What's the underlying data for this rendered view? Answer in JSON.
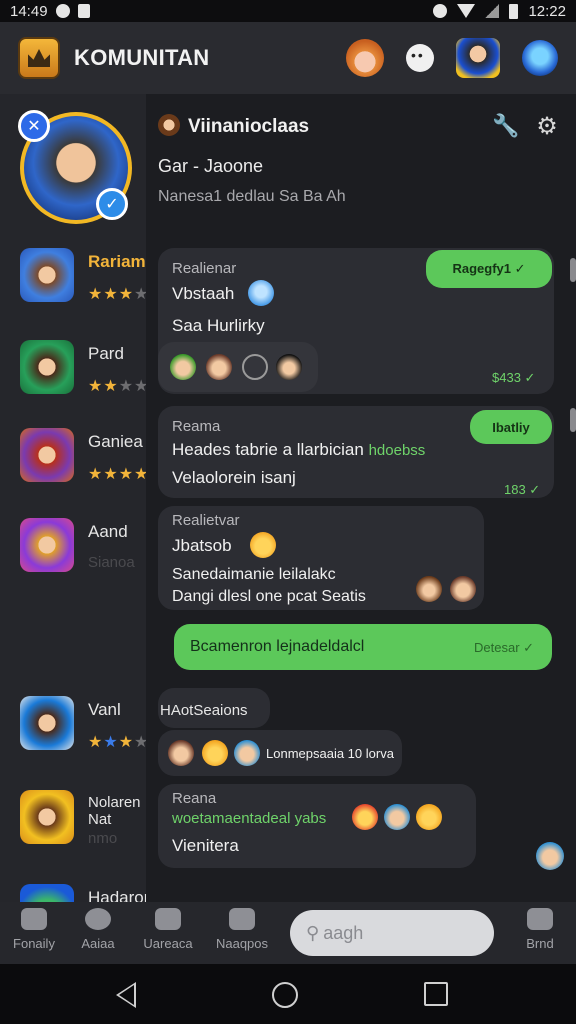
{
  "status_bar": {
    "time": "14:49",
    "clock_right": "12:22"
  },
  "app_bar": {
    "title": "KOMUNITAN"
  },
  "sidebar": {
    "games": [
      {
        "name": "Rariama",
        "rating": 3,
        "style": "gold"
      },
      {
        "name": "Pard",
        "rating": 2,
        "style": "plain"
      },
      {
        "name": "Ganiea",
        "rating": 4,
        "style": "plain"
      },
      {
        "name": "Aand",
        "sub": "Sianoa",
        "style": "plain"
      },
      {
        "name": "Vanl",
        "rating": 3,
        "style": "plain"
      },
      {
        "name": "Nolaren Nat",
        "sub": "nmo",
        "style": "plain"
      },
      {
        "name": "Hadaron",
        "style": "plain"
      }
    ]
  },
  "chat": {
    "header": {
      "name": "Viinanioclaas",
      "subtitle": "Gar - Jaoone",
      "status": "Nanesa1 dedlau Sa Ba Ah"
    },
    "messages": [
      {
        "who": "Realienar",
        "line1": "Vbstaah",
        "line2": "Saa Hurlirky",
        "pill": "Ragegfy1 ✓",
        "time": "$433 ✓"
      },
      {
        "who": "Reama",
        "line1": "Heades tabrie a llarbician",
        "line1_green": "hdoebss",
        "line2": "Velaolorein isanj",
        "pill": "Ibatliy",
        "time": "183 ✓"
      },
      {
        "who": "Realietvar",
        "line1": "Jbatsob",
        "line2": "Sanedaimanie leilalakc",
        "line3": "Dangi dlesl one pcat Seatis"
      },
      {
        "outgoing": "Bcamenron lejnadeldalcl",
        "outgoing_time": "Detesar ✓"
      },
      {
        "who": "HAotSeaions",
        "line1": "Lonmepsaaia 10 lorva"
      },
      {
        "who": "Reana",
        "line1_green": "woetamaentadeal yabs",
        "line2": "Vienitera"
      }
    ]
  },
  "bottom_nav": {
    "items": [
      {
        "label": "Fonaily"
      },
      {
        "label": "Aaiaa"
      },
      {
        "label": "Uareaca"
      },
      {
        "label": "Naaqpos"
      }
    ],
    "search_placeholder": "aagh",
    "last_item": "Brnd"
  }
}
